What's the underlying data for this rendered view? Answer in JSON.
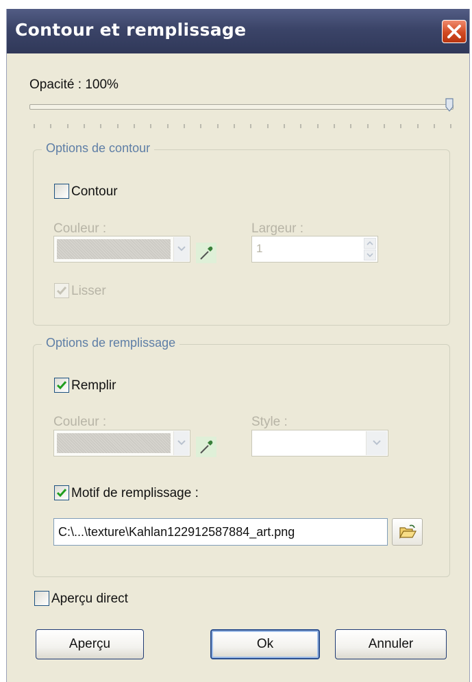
{
  "window": {
    "title": "Contour et remplissage"
  },
  "opacity": {
    "label": "Opacité : 100%",
    "value_percent": 100
  },
  "contour_group": {
    "legend": "Options de contour",
    "checkbox_label": "Contour",
    "checked": false,
    "color_label": "Couleur :",
    "width_label": "Largeur :",
    "width_value": "1",
    "smooth_label": "Lisser",
    "smooth_checked": true
  },
  "fill_group": {
    "legend": "Options de remplissage",
    "checkbox_label": "Remplir",
    "checked": true,
    "color_label": "Couleur :",
    "style_label": "Style :",
    "pattern_label": "Motif de remplissage :",
    "pattern_checked": true,
    "pattern_path": "C:\\...\\texture\\Kahlan122912587884_art.png"
  },
  "live_preview": {
    "label": "Aperçu direct",
    "checked": false
  },
  "buttons": {
    "preview": "Aperçu",
    "ok": "Ok",
    "cancel": "Annuler"
  },
  "icons": [
    "close-icon",
    "eyedropper-icon",
    "chevron-down-icon",
    "spin-up-icon",
    "spin-down-icon",
    "folder-open-icon",
    "checkmark-icon"
  ],
  "colors": {
    "title_bar": "#3b4468",
    "close": "#d24a22",
    "legend_text": "#5e7ea6",
    "check_green": "#1f9e1f"
  }
}
